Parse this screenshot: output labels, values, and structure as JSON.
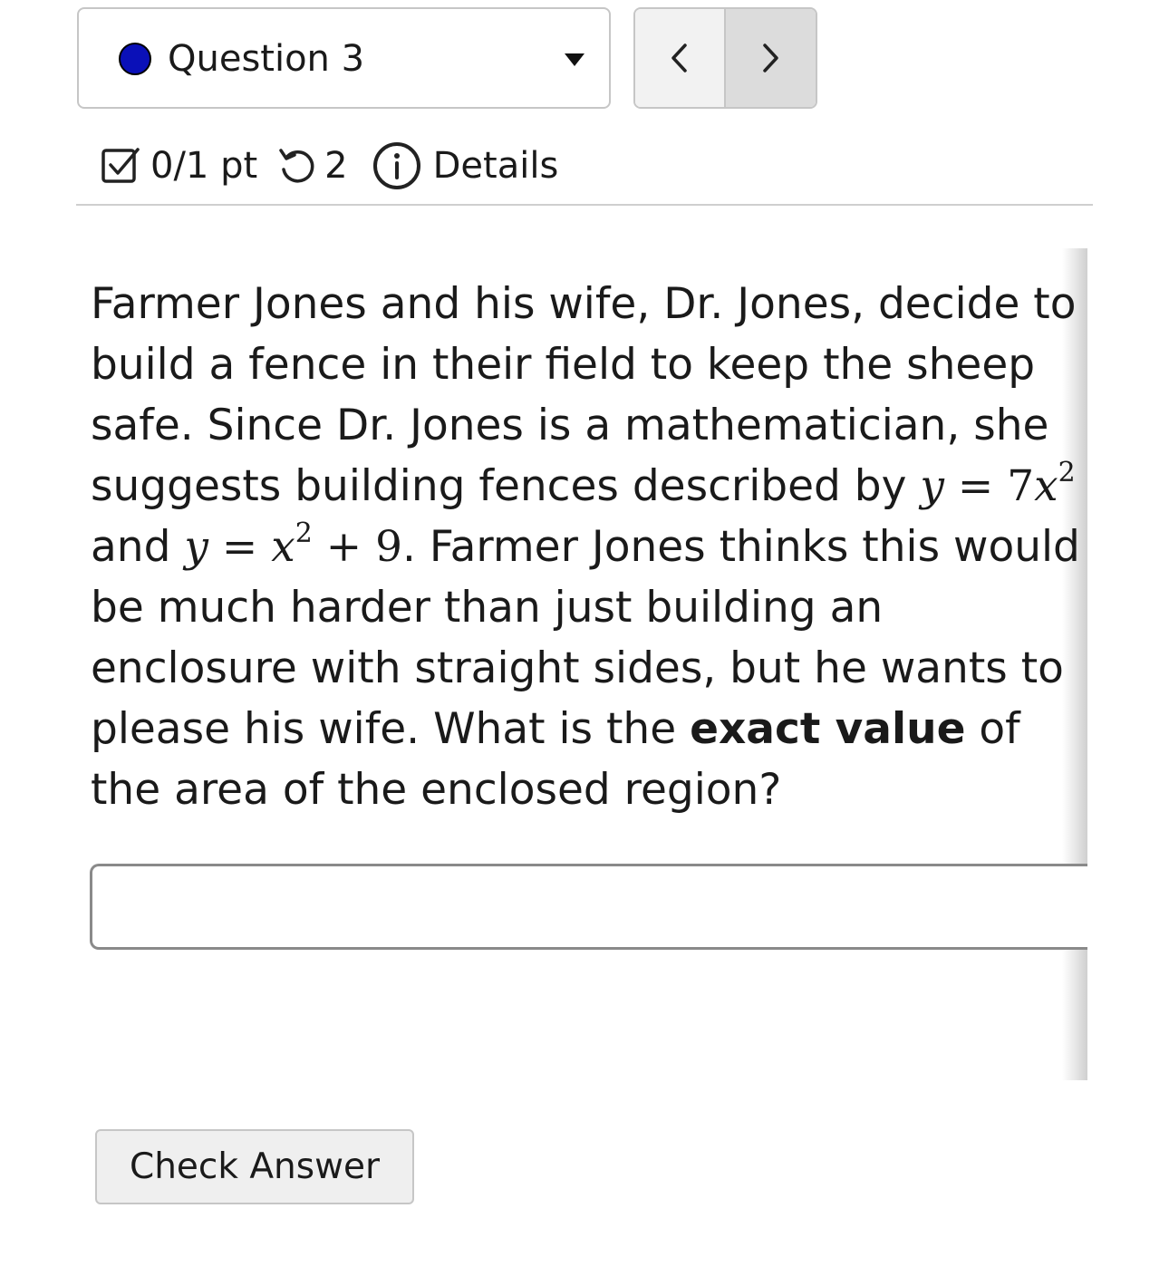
{
  "header": {
    "question_label": "Question 3",
    "status_color": "#0a10b8"
  },
  "nav": {
    "prev_icon": "chevron-left-icon",
    "next_icon": "chevron-right-icon"
  },
  "meta": {
    "points": "0/1 pt",
    "retries": "2",
    "details_label": "Details"
  },
  "question": {
    "part1": "Farmer Jones and his wife, Dr. Jones, decide to build a fence in their field to keep the sheep safe. Since Dr. Jones is a mathematician, she suggests building fences described by ",
    "eq1_lhs": "y",
    "eq1_eq": " = ",
    "eq1_coef": "7",
    "eq1_var": "x",
    "eq1_exp": "2",
    "part2": " and ",
    "eq2_lhs": "y",
    "eq2_eq": " = ",
    "eq2_var": "x",
    "eq2_exp": "2",
    "eq2_rest": " + 9",
    "part3": ". Farmer Jones thinks this would be much harder than just building an enclosure with straight sides, but he wants to please his wife. What is the ",
    "bold": "exact value",
    "part4": " of the area of the enclosed region?"
  },
  "answer": {
    "value": "",
    "placeholder": ""
  },
  "actions": {
    "check_label": "Check Answer"
  }
}
